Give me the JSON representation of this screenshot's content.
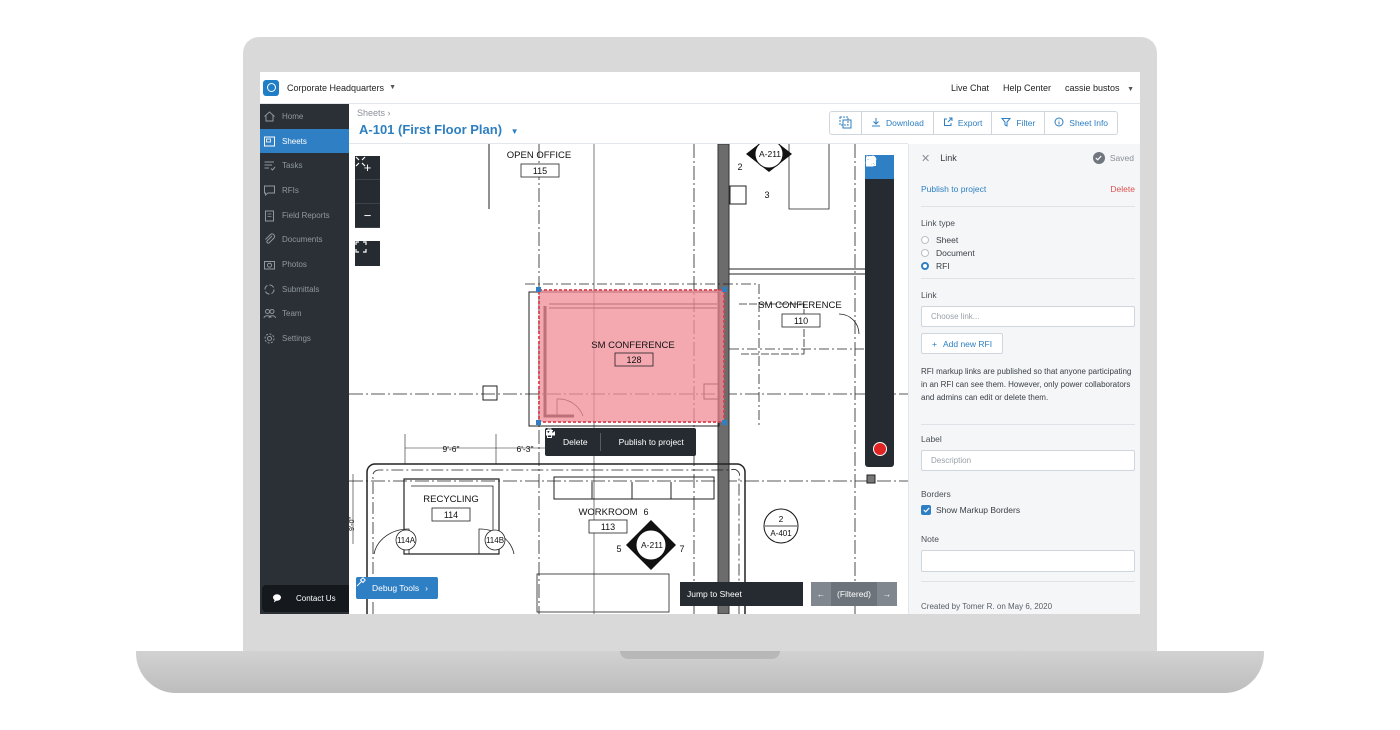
{
  "topbar": {
    "project": "Corporate Headquarters",
    "links": [
      "Live Chat",
      "Help Center"
    ],
    "user": "cassie bustos"
  },
  "sidebar": {
    "items": [
      {
        "label": "Home",
        "icon": "home-icon"
      },
      {
        "label": "Sheets",
        "icon": "sheets-icon",
        "active": true
      },
      {
        "label": "Tasks",
        "icon": "tasks-icon"
      },
      {
        "label": "RFIs",
        "icon": "rfi-icon"
      },
      {
        "label": "Field Reports",
        "icon": "clipboard-icon"
      },
      {
        "label": "Documents",
        "icon": "paperclip-icon"
      },
      {
        "label": "Photos",
        "icon": "camera-icon"
      },
      {
        "label": "Submittals",
        "icon": "cycle-icon"
      },
      {
        "label": "Team",
        "icon": "team-icon"
      },
      {
        "label": "Settings",
        "icon": "gear-icon"
      }
    ],
    "contact": "Contact Us"
  },
  "header": {
    "breadcrumb": "Sheets ›",
    "title": "A-101 (First Floor Plan)",
    "buttons": {
      "download": "Download",
      "export": "Export",
      "filter": "Filter",
      "sheet_info": "Sheet Info"
    }
  },
  "drawing": {
    "rooms": {
      "open_office": {
        "name": "OPEN OFFICE",
        "number": "115"
      },
      "sm_conf_selected": {
        "name": "SM CONFERENCE",
        "number": "128"
      },
      "sm_conf_right": {
        "name": "SM CONFERENCE",
        "number": "110"
      },
      "recycling": {
        "name": "RECYCLING",
        "number": "114"
      },
      "workroom": {
        "name": "WORKROOM",
        "number": "113"
      }
    },
    "tags": {
      "door_a": "114A",
      "door_b": "114B",
      "section_top": "A-211",
      "section_top_num_left": "2",
      "section_top_num_bottom": "3",
      "section_mid": "A-211",
      "section_mid_num_top": "6",
      "section_mid_num_left": "5",
      "section_mid_num_right": "7",
      "detail_num": "2",
      "detail_sheet": "A-401",
      "dim_1": "9'-6\"",
      "dim_2": "6'-3\"",
      "dim_side": "9'-0\""
    },
    "markup_color": "#f08c97"
  },
  "selection_popup": {
    "delete": "Delete",
    "publish": "Publish to project"
  },
  "bottom": {
    "debug": "Debug Tools",
    "jump": "Jump to Sheet",
    "filtered": "(Filtered)"
  },
  "panel": {
    "title": "Link",
    "saved": "Saved",
    "publish": "Publish to project",
    "delete": "Delete",
    "link_type_label": "Link type",
    "link_types": [
      {
        "label": "Sheet",
        "checked": false
      },
      {
        "label": "Document",
        "checked": false
      },
      {
        "label": "RFI",
        "checked": true
      }
    ],
    "link_label": "Link",
    "link_placeholder": "Choose link...",
    "add_new": "Add new RFI",
    "info": "RFI markup links are published so that anyone participating in an RFI can see them. However, only power collaborators and admins can edit or delete them.",
    "label_label": "Label",
    "label_placeholder": "Description",
    "borders_label": "Borders",
    "borders_checkbox": "Show Markup Borders",
    "note_label": "Note",
    "created": "Created by Tomer R. on May 6, 2020"
  }
}
